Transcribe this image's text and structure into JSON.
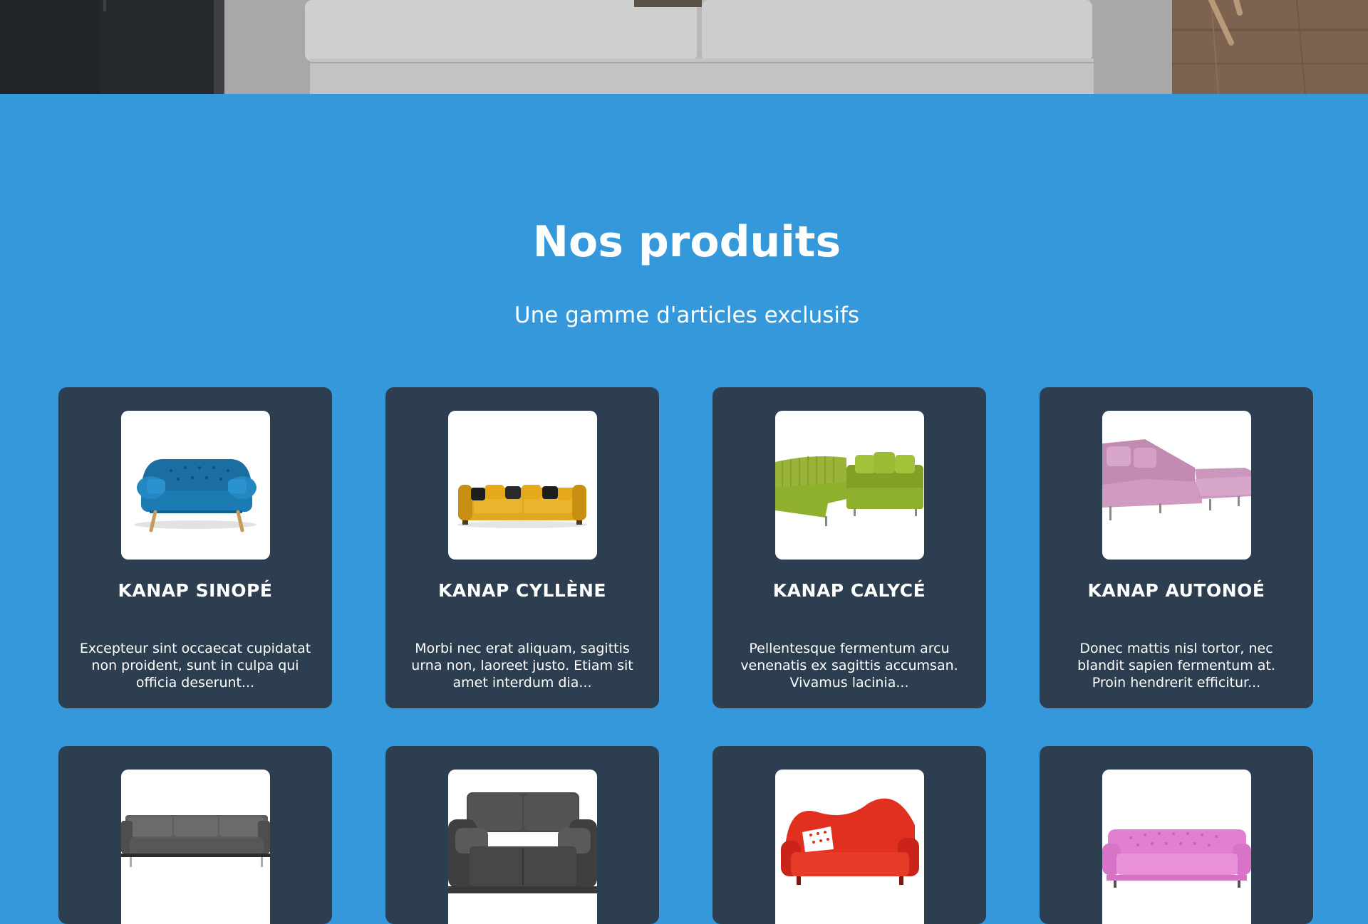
{
  "hero": {
    "image": "living-room-sofa-photo",
    "colors": {
      "floor": "#7a5e48",
      "sofa": "#c9c8c8",
      "wall": "#2b2c2f"
    }
  },
  "section": {
    "title": "Nos produits",
    "subtitle": "Une gamme d'articles exclusifs",
    "background": "#3498db",
    "card_background": "#2c3e50"
  },
  "products": [
    {
      "name": "KANAP SINOPÉ",
      "description": "Excepteur sint occaecat cupidatat non proident, sunt in culpa qui officia deserunt...",
      "image": "blue-sofa-image",
      "color": "#1d7bb3"
    },
    {
      "name": "KANAP CYLLÈNE",
      "description": "Morbi nec erat aliquam, sagittis urna non, laoreet justo. Etiam sit amet interdum dia...",
      "image": "yellow-sofa-image",
      "color": "#e0a820"
    },
    {
      "name": "KANAP CALYCÉ",
      "description": "Pellentesque fermentum arcu venenatis ex sagittis accumsan. Vivamus lacinia...",
      "image": "green-sectional-sofa-image",
      "color": "#8fb02c"
    },
    {
      "name": "KANAP AUTONOÉ",
      "description": "Donec mattis nisl tortor, nec blandit sapien fermentum at. Proin hendrerit efficitur...",
      "image": "pink-sofa-image",
      "color": "#cf9bc0"
    },
    {
      "image": "grey-sofa-image",
      "color": "#5e5e60"
    },
    {
      "image": "dark-grey-sofa-image",
      "color": "#454545"
    },
    {
      "image": "red-sofa-image",
      "color": "#e1301f"
    },
    {
      "image": "pink-chesterfield-sofa-image",
      "color": "#e27fd1"
    }
  ]
}
